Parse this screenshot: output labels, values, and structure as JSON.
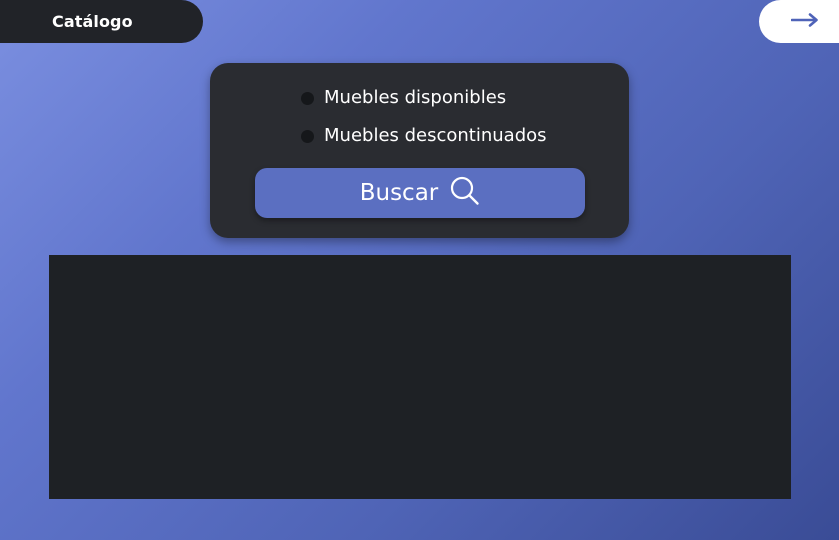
{
  "header": {
    "title": "Catálogo",
    "next_icon": "arrow-right-icon"
  },
  "filters": {
    "options": [
      {
        "label": "Muebles disponibles",
        "selected": false
      },
      {
        "label": "Muebles descontinuados",
        "selected": false
      }
    ]
  },
  "search": {
    "label": "Buscar",
    "icon": "search-icon"
  },
  "colors": {
    "accent": "#5b6fc1",
    "panel": "#2a2c31",
    "results_background": "#1e2125"
  }
}
